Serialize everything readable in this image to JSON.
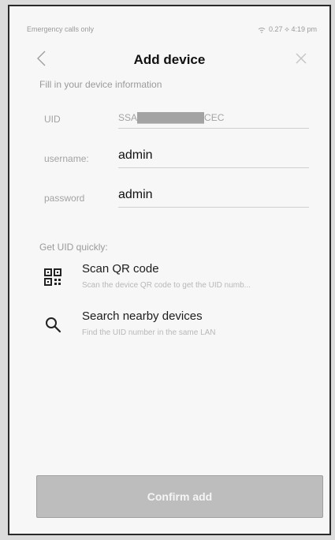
{
  "status_bar": {
    "left_text": "Emergency calls only",
    "right_text": "0.27 ⟡ 4:19 pm"
  },
  "header": {
    "title": "Add device",
    "back_icon": "chevron-left-icon",
    "close_icon": "close-icon"
  },
  "form": {
    "section_title": "Fill in your device information",
    "fields": [
      {
        "label": "UID",
        "value": "SSA██████████CEC",
        "muted": true
      },
      {
        "label": "username:",
        "value": "admin"
      },
      {
        "label": "password",
        "value": "admin"
      }
    ]
  },
  "quick_uid": {
    "section_title": "Get UID quickly:",
    "items": [
      {
        "icon": "qr-code-icon",
        "title": "Scan QR code",
        "description": "Scan the device QR code to get the UID numb..."
      },
      {
        "icon": "search-icon",
        "title": "Search nearby devices",
        "description": "Find the UID number in the same LAN"
      }
    ]
  },
  "footer": {
    "confirm_label": "Confirm add"
  },
  "colors": {
    "background": "#f7f7f7",
    "text_primary": "#111111",
    "text_muted": "#a3a3a3",
    "button_disabled": "#bdbdbd"
  }
}
